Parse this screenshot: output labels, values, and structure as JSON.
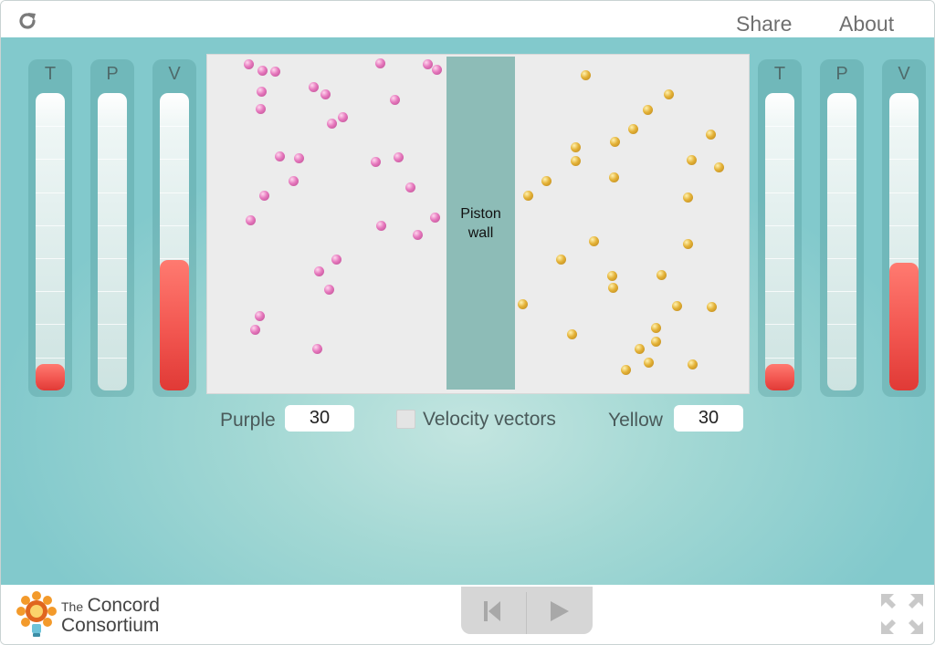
{
  "topbar": {
    "share_label": "Share",
    "about_label": "About",
    "reload_icon": "reload-icon"
  },
  "left_gauges": [
    {
      "label": "T",
      "level": 0.09
    },
    {
      "label": "P",
      "level": 0.0
    },
    {
      "label": "V",
      "level": 0.44
    }
  ],
  "right_gauges": [
    {
      "label": "T",
      "level": 0.09
    },
    {
      "label": "P",
      "level": 0.0
    },
    {
      "label": "V",
      "level": 0.43
    }
  ],
  "simulation": {
    "piston_label_line1": "Piston",
    "piston_label_line2": "wall",
    "purple_color": "#e07cbf",
    "yellow_color": "#e1b032"
  },
  "controls": {
    "purple_label": "Purple",
    "purple_value": "30",
    "velocity_label": "Velocity vectors",
    "velocity_checked": false,
    "yellow_label": "Yellow",
    "yellow_value": "30"
  },
  "footer": {
    "logo_the": "The",
    "logo_line1": "Concord",
    "logo_line2": "Consortium",
    "player": [
      "step-back-icon",
      "play-icon"
    ],
    "fullscreen_icon": "fullscreen-icon"
  }
}
